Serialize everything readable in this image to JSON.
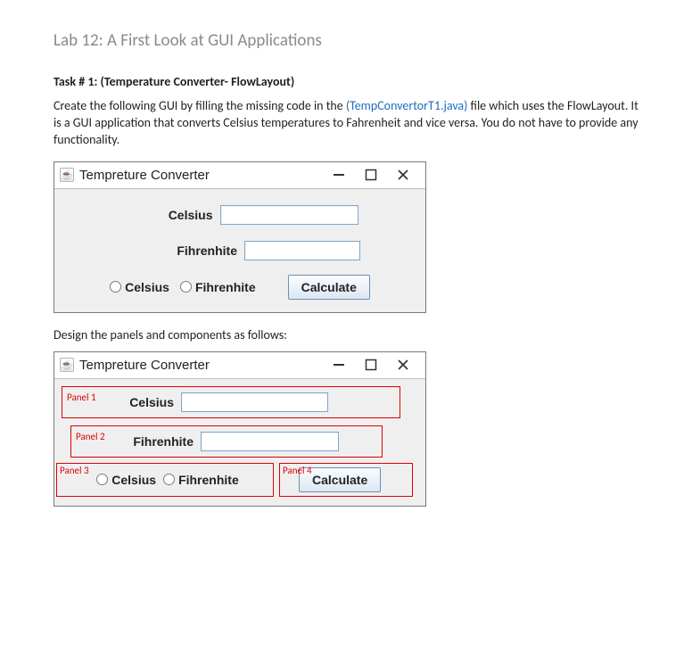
{
  "page": {
    "title": "Lab 12: A First Look at GUI Applications"
  },
  "task": {
    "heading": "Task # 1: (Temperature Converter- FlowLayout)",
    "desc_before": "Create the following GUI by filling the missing code in the ",
    "link_text": "(TempConvertorT1.java)",
    "desc_after": " file which uses the FlowLayout.  It is a GUI application that converts Celsius temperatures to Fahrenheit and vice versa.  You do not have to provide any functionality."
  },
  "win1": {
    "title": "Tempreture Converter",
    "label_celsius": "Celsius",
    "label_fahrenheit": "Fihrenhite",
    "radio_celsius": "Celsius",
    "radio_fahrenheit": "Fihrenhite",
    "calculate": "Calculate"
  },
  "mid_text": "Design the panels and components as follows:",
  "win2": {
    "title": "Tempreture Converter",
    "label_celsius": "Celsius",
    "label_fahrenheit": "Fihrenhite",
    "radio_celsius": "Celsius",
    "radio_fahrenheit": "Fihrenhite",
    "calculate": "Calculate",
    "panel1": "Panel 1",
    "panel2": "Panel 2",
    "panel3": "Panel 3",
    "panel4": "Panel 4"
  }
}
